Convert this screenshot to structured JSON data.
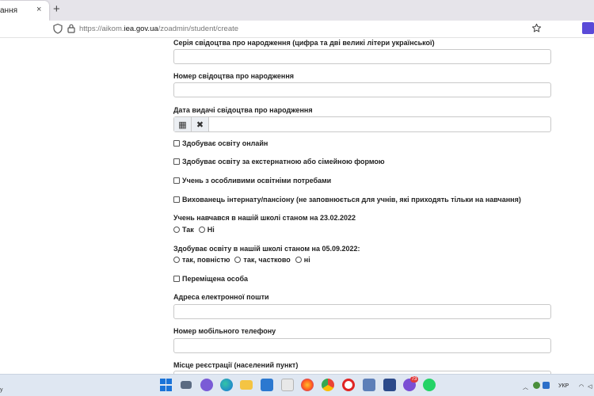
{
  "browser": {
    "tab_title": "ання",
    "tab_close": "×",
    "new_tab": "+",
    "url_prefix": "https://aikom.",
    "url_domain": "iea.gov.ua",
    "url_path": "/zoadmin/student/create"
  },
  "form": {
    "birth_cert_series_label": "Серія свідоцтва про народження (цифра та дві великі літери української)",
    "birth_cert_number_label": "Номер свідоцтва про народження",
    "birth_cert_date_label": "Дата видачі свідоцтва про народження",
    "calendar_btn": "▦",
    "clear_btn": "✖",
    "checkboxes": [
      "Здобуває освіту онлайн",
      "Здобуває освіту за екстернатною або сімейною формою",
      "Учень з особливими освітніми потребами",
      "Вихованець інтернату/пансіону (не заповнюється для учнів, які приходять тільки на навчання)"
    ],
    "q1_label": "Учень навчався в нашій школі станом на 23.02.2022",
    "q1_options": [
      "Так",
      "Ні"
    ],
    "q2_label": "Здобуває освіту в нашій школі станом на 05.09.2022:",
    "q2_options": [
      "так, повністю",
      "так, частково",
      "ні"
    ],
    "displaced_label": "Переміщена особа",
    "email_label": "Адреса електронної пошти",
    "phone_label": "Номер мобільного телефону",
    "registration_label": "Місце реєстрації (населений пункт)"
  },
  "taskbar": {
    "left_text": "у",
    "lang": "УКР",
    "badge": "73"
  },
  "colors": {
    "tab_bg": "#e6e4ea",
    "taskbar_bg": "#dfe7f2",
    "firefox_accent": "#5a4ad8"
  }
}
